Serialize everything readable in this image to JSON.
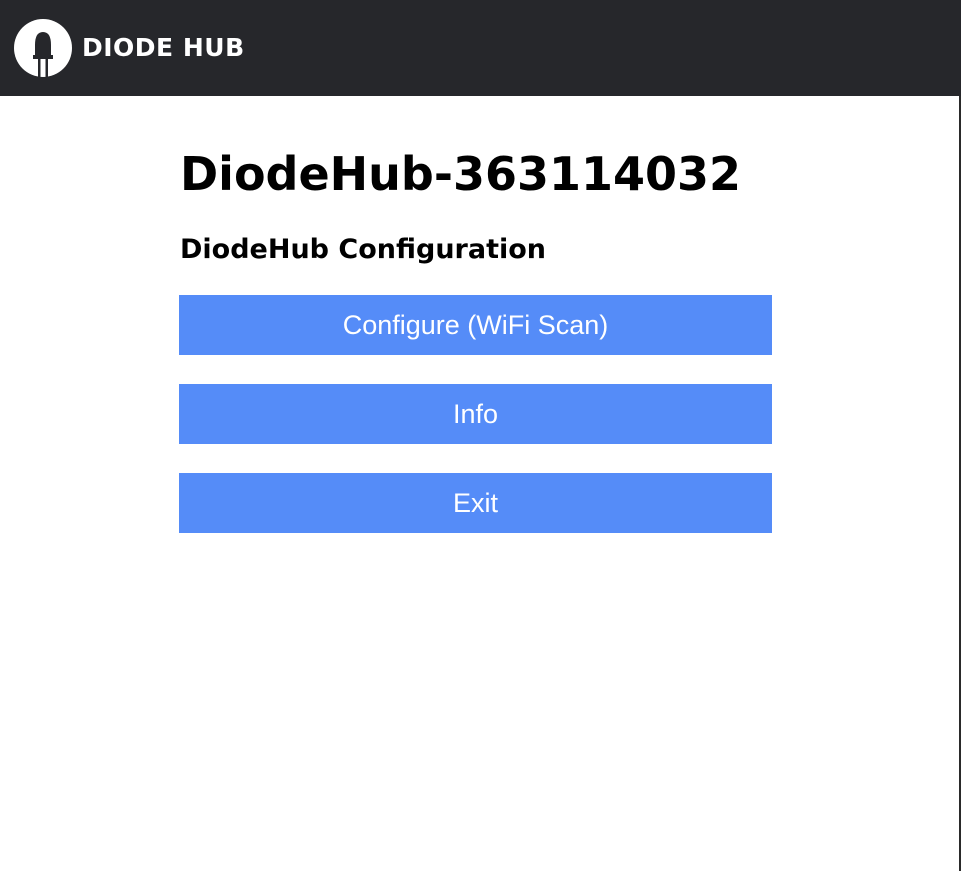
{
  "header": {
    "brand": "DIODE HUB",
    "logo_icon": "diode-led-icon",
    "background_color": "#26272b"
  },
  "main": {
    "device_title": "DiodeHub-363114032",
    "section_title": "DiodeHub Configuration",
    "buttons": [
      {
        "label": "Configure (WiFi Scan)"
      },
      {
        "label": "Info"
      },
      {
        "label": "Exit"
      }
    ],
    "button_color": "#558cf8"
  }
}
